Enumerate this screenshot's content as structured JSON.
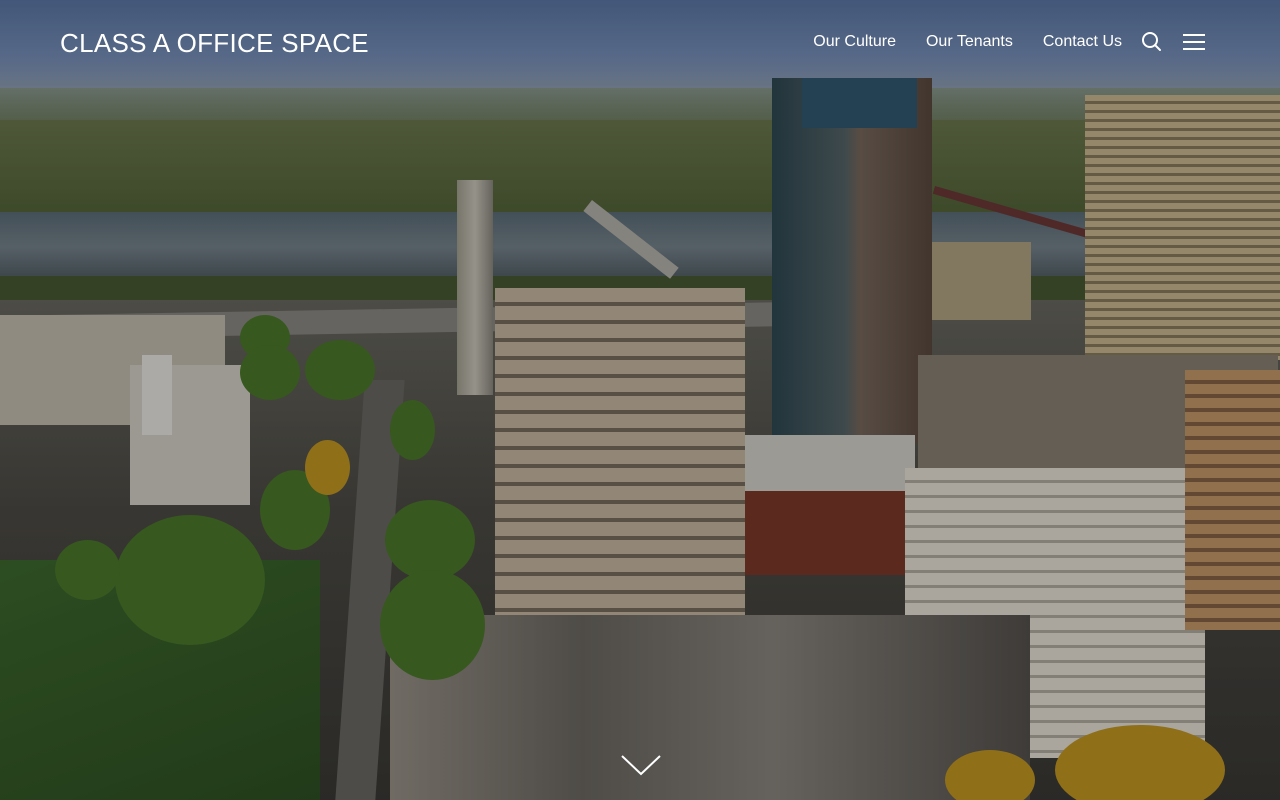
{
  "site": {
    "title": "CLASS A OFFICE SPACE"
  },
  "nav": {
    "items": [
      {
        "label": "Our Culture"
      },
      {
        "label": "Our Tenants"
      },
      {
        "label": "Contact Us"
      }
    ]
  },
  "icons": {
    "search": "search-icon",
    "menu": "menu-icon",
    "scroll": "chevron-down-icon"
  },
  "hero": {
    "image": "aerial-city-view"
  },
  "colors": {
    "header_text": "#ffffff",
    "overlay": "rgba(0,0,0,0.28)"
  }
}
